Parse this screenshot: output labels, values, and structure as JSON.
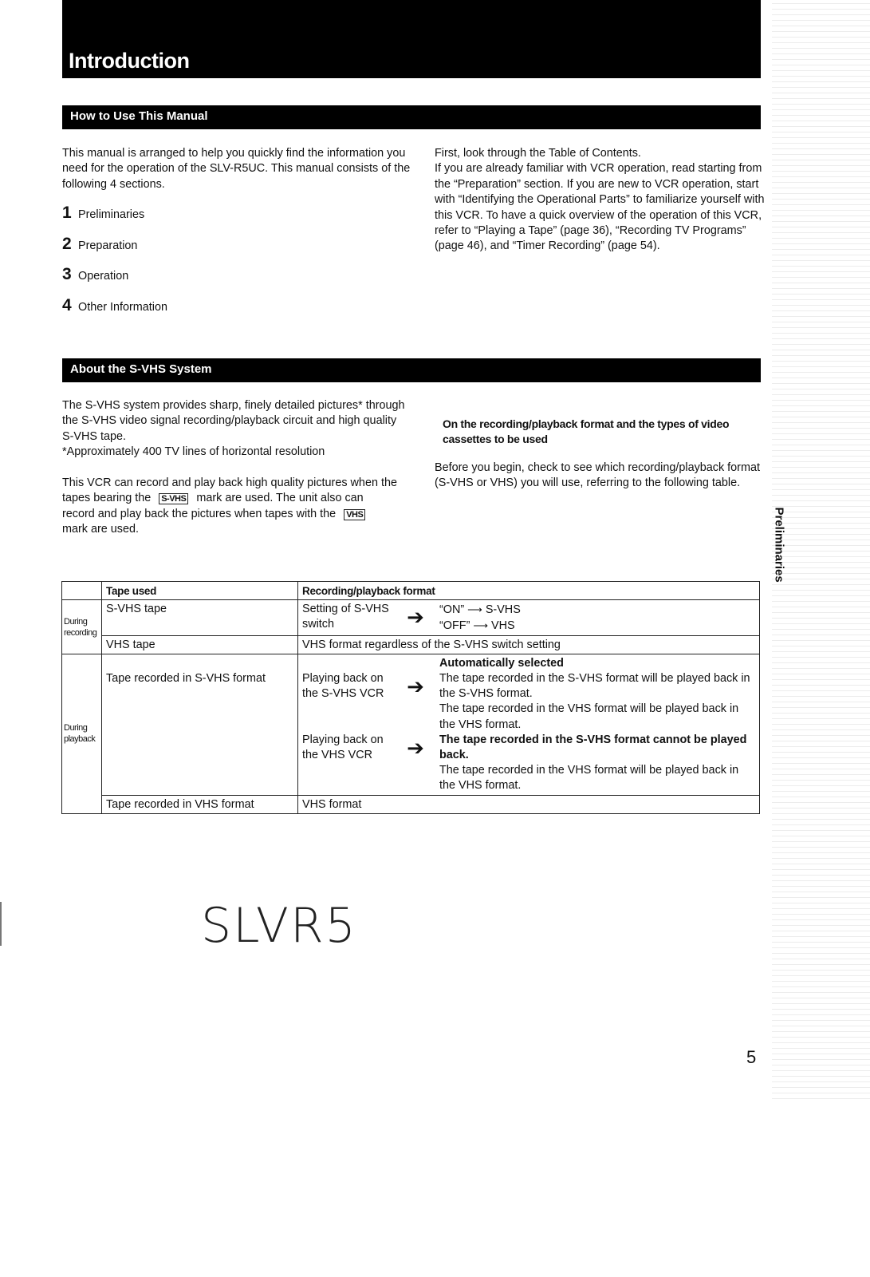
{
  "header": {
    "title": "Introduction"
  },
  "how_to_use": {
    "heading": "How to Use This Manual",
    "intro": "This manual is arranged to help you quickly find the information you need for the operation of the SLV-R5UC. This manual consists of the following 4 sections.",
    "sections": [
      {
        "num": "1",
        "name": "Preliminaries"
      },
      {
        "num": "2",
        "name": "Preparation"
      },
      {
        "num": "3",
        "name": "Operation"
      },
      {
        "num": "4",
        "name": "Other Information"
      }
    ],
    "right_text": "First, look through the Table of Contents.\nIf you are already familiar with VCR operation, read starting from the “Preparation” section. If you are new to VCR operation, start with “Identifying the Operational Parts” to familiarize yourself with this VCR. To have a quick overview of the operation of this VCR, refer to “Playing a Tape” (page 36), “Recording TV Programs” (page 46), and “Timer Recording” (page 54)."
  },
  "svhs": {
    "heading": "About the S-VHS System",
    "para1": "The S-VHS system provides sharp, finely detailed pictures* through the S-VHS video signal recording/playback circuit and high quality S-VHS tape.",
    "footnote": "*Approximately 400 TV lines of horizontal resolution",
    "para2_a": "This VCR can record and play back high quality pictures when the tapes bearing the",
    "mark_svhs": "S-VHS",
    "para2_b": "mark are used. The unit also can record and play back the pictures when tapes with the",
    "mark_vhs": "VHS",
    "para2_c": "mark are used.",
    "subheading": "On the recording/playback format and the types of video cassettes to be used",
    "before_text": "Before you begin, check to see which recording/playback format (S-VHS or VHS) you will use, referring to the following table."
  },
  "table": {
    "headers": {
      "tape_used": "Tape used",
      "format": "Recording/playback format"
    },
    "recording_group": "During recording",
    "playback_group": "During playback",
    "rec_row1": {
      "tape": "S-VHS tape",
      "lhs": "Setting of S-VHS switch",
      "on": "“ON”",
      "on_result": "S-VHS",
      "off": "“OFF”",
      "off_result": "VHS"
    },
    "rec_row2": {
      "tape": "VHS tape",
      "format": "VHS format regardless of the S-VHS switch setting"
    },
    "play_row1": {
      "tape": "Tape recorded in S-VHS format",
      "auto_label": "Automatically selected",
      "svhs_vcr": "Playing back on the S-VHS VCR",
      "svhs_vcr_r1": "The tape recorded in the S-VHS format will be played back in the S-VHS format.",
      "svhs_vcr_r2": "The tape recorded in the VHS format will be played back in the VHS format.",
      "vhs_vcr": "Playing back on the VHS VCR",
      "vhs_vcr_r1": "The tape recorded in the S-VHS format cannot be played back.",
      "vhs_vcr_r2": "The tape recorded in the VHS format will be played back in the VHS format."
    },
    "play_row2": {
      "tape": "Tape recorded in VHS format",
      "format": "VHS format"
    }
  },
  "side_tab": "Preliminaries",
  "handwritten_note": "SLVR5",
  "page_number": "5"
}
